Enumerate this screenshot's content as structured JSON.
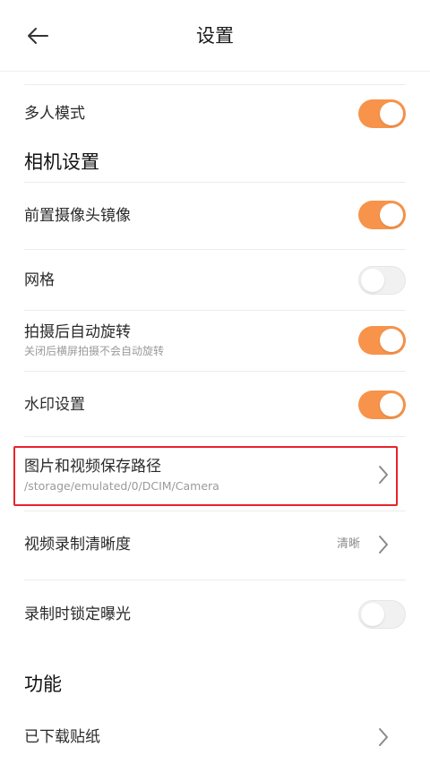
{
  "header": {
    "title": "设置"
  },
  "rows": {
    "multi_mode": {
      "label": "多人模式",
      "enabled": true
    },
    "front_mirror": {
      "label": "前置摄像头镜像",
      "enabled": true
    },
    "grid": {
      "label": "网格",
      "enabled": false
    },
    "auto_rotate": {
      "label": "拍摄后自动旋转",
      "subtitle": "关闭后横屏拍摄不会自动旋转",
      "enabled": true
    },
    "watermark": {
      "label": "水印设置",
      "enabled": true
    },
    "save_path": {
      "label": "图片和视频保存路径",
      "subtitle": "/storage/emulated/0/DCIM/Camera"
    },
    "video_quality": {
      "label": "视频录制清晰度",
      "value": "清晰"
    },
    "lock_exposure": {
      "label": "录制时锁定曝光",
      "enabled": false
    },
    "stickers": {
      "label": "已下载贴纸"
    }
  },
  "sections": {
    "camera": "相机设置",
    "features": "功能"
  },
  "colors": {
    "accent": "#f7934a",
    "highlight": "#e8232b",
    "toggle_off": "#f1f1f1"
  },
  "icons": {
    "back": "arrow-left-icon",
    "chevron": "chevron-right-icon"
  }
}
